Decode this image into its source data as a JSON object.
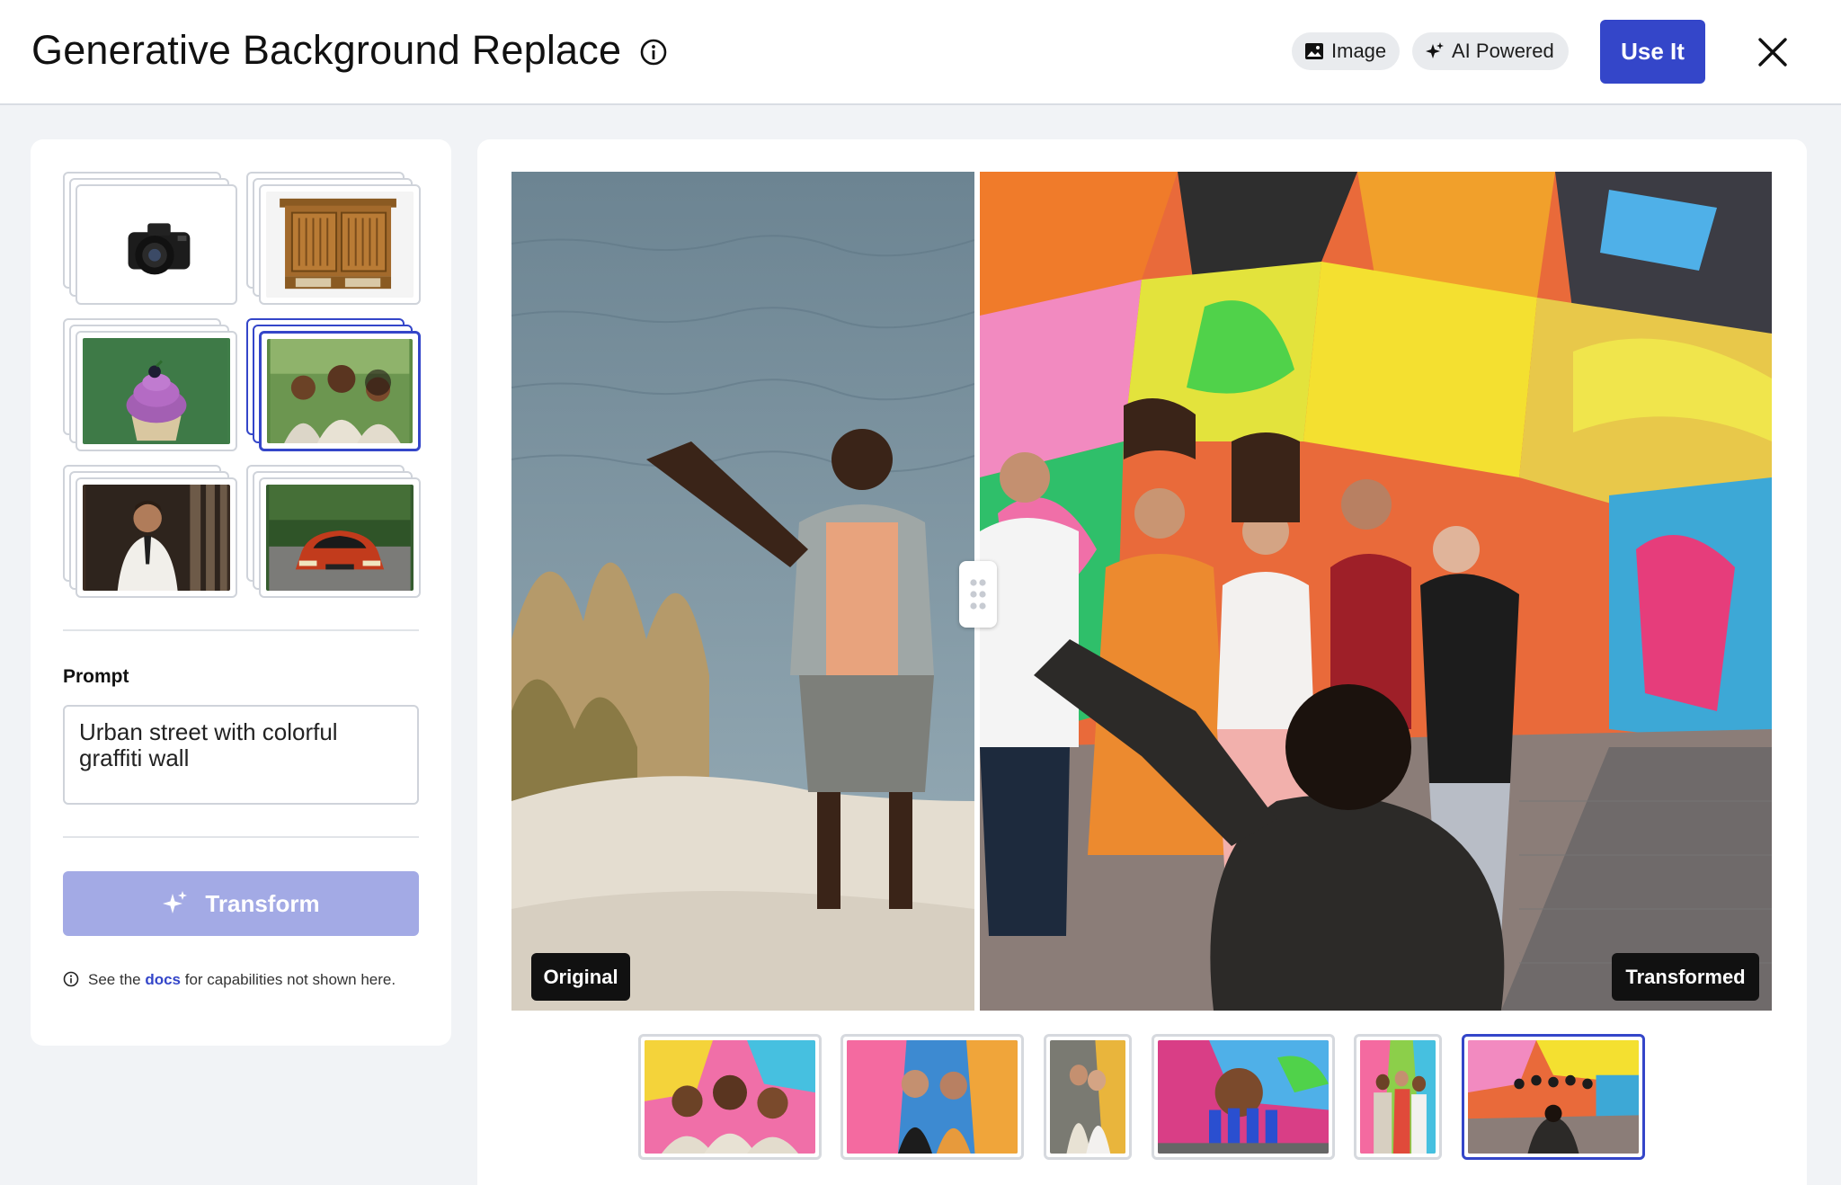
{
  "header": {
    "title": "Generative Background Replace",
    "pill_image": "Image",
    "pill_ai": "AI Powered",
    "use_it": "Use It"
  },
  "left_panel": {
    "thumbnails": [
      {
        "name": "camera"
      },
      {
        "name": "cabinet"
      },
      {
        "name": "cupcake"
      },
      {
        "name": "group-selfie",
        "selected": true
      },
      {
        "name": "man-in-suit"
      },
      {
        "name": "red-car"
      }
    ],
    "prompt_label": "Prompt",
    "prompt_value": "Urban street with colorful graffiti wall",
    "transform_label": "Transform",
    "note_prefix": "See the ",
    "note_link": "docs",
    "note_suffix": " for capabilities not shown here."
  },
  "viewer": {
    "original_label": "Original",
    "transformed_label": "Transformed"
  },
  "filmstrip": [
    {
      "name": "result-1"
    },
    {
      "name": "result-2"
    },
    {
      "name": "result-3"
    },
    {
      "name": "result-4"
    },
    {
      "name": "result-5"
    },
    {
      "name": "result-6",
      "selected": true
    }
  ],
  "colors": {
    "accent": "#3446c9",
    "accent_disabled": "#a3aae5"
  }
}
